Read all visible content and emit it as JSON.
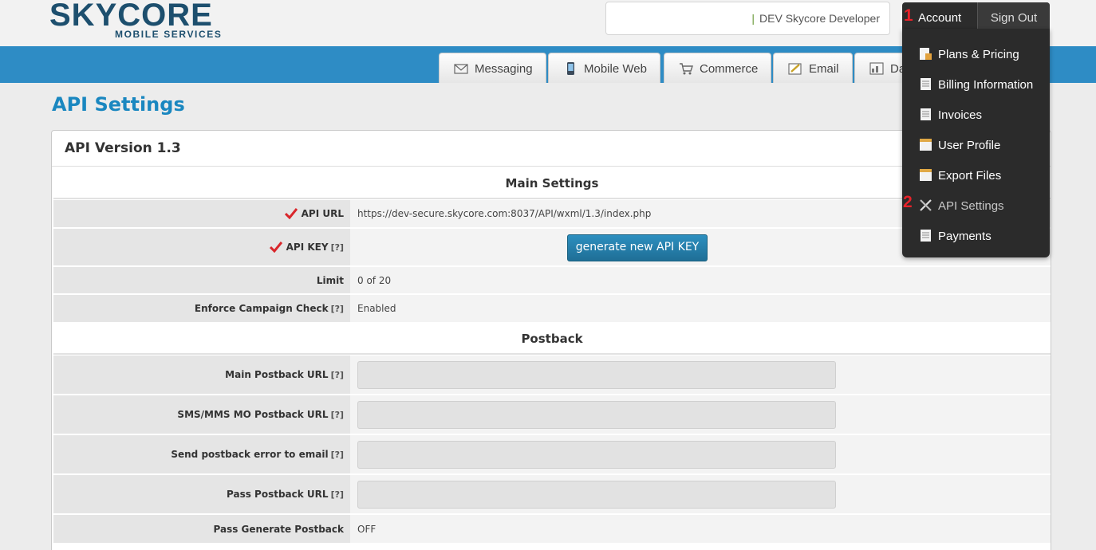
{
  "header": {
    "logo_main": "SKYCORE",
    "logo_sub": "MOBILE SERVICES",
    "user_separator": "|",
    "user_name": "DEV Skycore Developer",
    "account_label": "Account",
    "signout_label": "Sign Out"
  },
  "annotations": {
    "one": "1",
    "two": "2",
    "color": "#e8222a"
  },
  "tabs": [
    {
      "label": "Messaging",
      "icon": "envelope-icon"
    },
    {
      "label": "Mobile Web",
      "icon": "mobile-phone-icon"
    },
    {
      "label": "Commerce",
      "icon": "shopping-cart-icon"
    },
    {
      "label": "Email",
      "icon": "email-icon"
    },
    {
      "label": "Da",
      "icon": "dashboard-icon"
    }
  ],
  "page_title": "API Settings",
  "panel": {
    "title": "API Version 1.3",
    "main_settings": {
      "heading": "Main Settings",
      "api_url_label": "API URL",
      "api_url_value": "https://dev-secure.skycore.com:8037/API/wxml/1.3/index.php",
      "api_key_label": "API KEY",
      "help": "[?]",
      "generate_label": "generate new API KEY",
      "limit_label": "Limit",
      "limit_value": "0 of 20",
      "enforce_label": "Enforce Campaign Check",
      "enforce_value": "Enabled"
    },
    "postback": {
      "heading": "Postback",
      "main_url_label": "Main Postback URL",
      "main_url_value": "",
      "mo_url_label": "SMS/MMS MO Postback URL",
      "mo_url_value": "",
      "error_email_label": "Send postback error to email",
      "error_email_value": "",
      "pass_url_label": "Pass Postback URL",
      "pass_url_value": "",
      "pass_generate_label": "Pass Generate Postback",
      "pass_generate_value": "OFF"
    }
  },
  "menu": {
    "items": [
      {
        "label": "Plans & Pricing",
        "icon": "plans-pricing-icon"
      },
      {
        "label": "Billing Information",
        "icon": "document-icon"
      },
      {
        "label": "Invoices",
        "icon": "document-icon"
      },
      {
        "label": "User Profile",
        "icon": "folder-icon"
      },
      {
        "label": "Export Files",
        "icon": "folder-icon"
      },
      {
        "label": "API Settings",
        "icon": "tools-icon",
        "active": true
      },
      {
        "label": "Payments",
        "icon": "document-icon"
      }
    ]
  },
  "colors": {
    "brand": "#1d4f6e",
    "nav_blue": "#2e8cc5",
    "title_blue": "#1a87c0",
    "check_red": "#d9262b",
    "menu_bg": "#2b2b2b"
  }
}
